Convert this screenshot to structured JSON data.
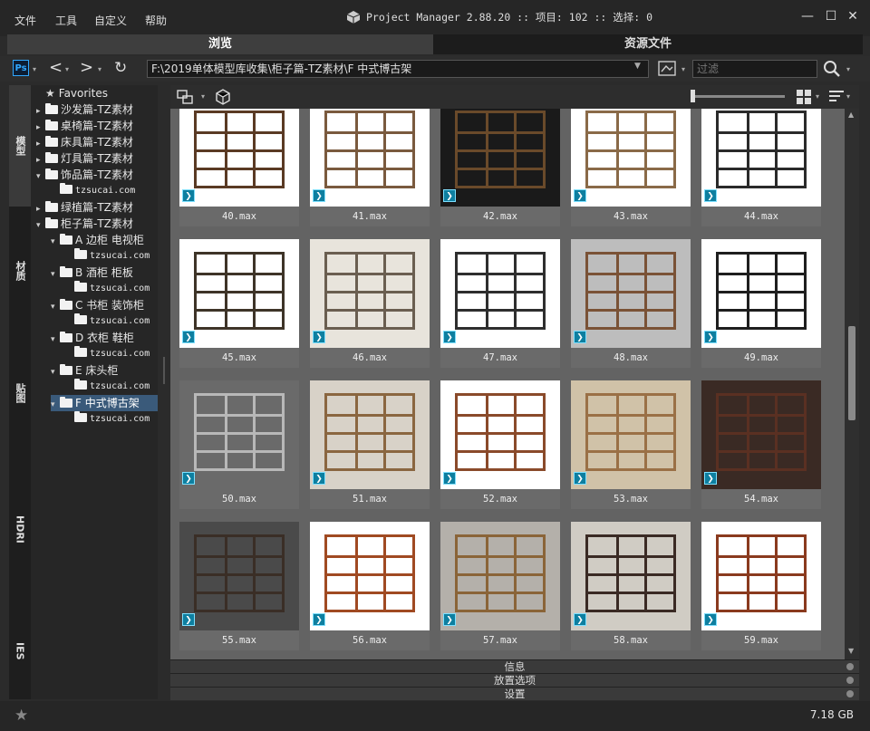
{
  "menu": [
    "文件",
    "工具",
    "自定义",
    "帮助"
  ],
  "title": "Project Manager 2.88.20 :: 项目: 102 :: 选择: 0",
  "tabs": {
    "browse": "浏览",
    "assets": "资源文件"
  },
  "toolbar": {
    "ps_label": "Ps",
    "path": "F:\\2019单体模型库收集\\柜子篇-TZ素材\\F 中式博古架",
    "filter_placeholder": "过滤"
  },
  "vtabs": [
    "模型",
    "材质",
    "贴图",
    "HDRI",
    "IES"
  ],
  "tree": [
    {
      "label": "Favorites",
      "level": 0,
      "arrow": "",
      "icon": "star"
    },
    {
      "label": "沙发篇-TZ素材",
      "level": 0,
      "arrow": "▸",
      "icon": "folder"
    },
    {
      "label": "桌椅篇-TZ素材",
      "level": 0,
      "arrow": "▸",
      "icon": "folder"
    },
    {
      "label": "床具篇-TZ素材",
      "level": 0,
      "arrow": "▸",
      "icon": "folder"
    },
    {
      "label": "灯具篇-TZ素材",
      "level": 0,
      "arrow": "▸",
      "icon": "folder"
    },
    {
      "label": "饰品篇-TZ素材",
      "level": 0,
      "arrow": "▾",
      "icon": "folder"
    },
    {
      "label": "tzsucai.com",
      "level": 1,
      "arrow": "",
      "icon": "folder",
      "mono": true
    },
    {
      "label": "绿植篇-TZ素材",
      "level": 0,
      "arrow": "▸",
      "icon": "folder"
    },
    {
      "label": "柜子篇-TZ素材",
      "level": 0,
      "arrow": "▾",
      "icon": "folder"
    },
    {
      "label": "A 边柜 电视柜",
      "level": 1,
      "arrow": "▾",
      "icon": "folder"
    },
    {
      "label": "tzsucai.com",
      "level": 2,
      "arrow": "",
      "icon": "folder",
      "mono": true
    },
    {
      "label": "B 酒柜 柜板",
      "level": 1,
      "arrow": "▾",
      "icon": "folder"
    },
    {
      "label": "tzsucai.com",
      "level": 2,
      "arrow": "",
      "icon": "folder",
      "mono": true
    },
    {
      "label": "C 书柜 装饰柜",
      "level": 1,
      "arrow": "▾",
      "icon": "folder"
    },
    {
      "label": "tzsucai.com",
      "level": 2,
      "arrow": "",
      "icon": "folder",
      "mono": true
    },
    {
      "label": "D 衣柜 鞋柜",
      "level": 1,
      "arrow": "▾",
      "icon": "folder"
    },
    {
      "label": "tzsucai.com",
      "level": 2,
      "arrow": "",
      "icon": "folder",
      "mono": true
    },
    {
      "label": "E 床头柜",
      "level": 1,
      "arrow": "▾",
      "icon": "folder"
    },
    {
      "label": "tzsucai.com",
      "level": 2,
      "arrow": "",
      "icon": "folder",
      "mono": true
    },
    {
      "label": "F 中式博古架",
      "level": 1,
      "arrow": "▾",
      "icon": "folder",
      "selected": true
    },
    {
      "label": "tzsucai.com",
      "level": 2,
      "arrow": "",
      "icon": "folder",
      "mono": true
    }
  ],
  "items": [
    {
      "label": "40.max",
      "bg": "#ffffff",
      "wood": "#5a3a24"
    },
    {
      "label": "41.max",
      "bg": "#ffffff",
      "wood": "#7a5a3e"
    },
    {
      "label": "42.max",
      "bg": "#1a1a1a",
      "wood": "#6a4a2a"
    },
    {
      "label": "43.max",
      "bg": "#ffffff",
      "wood": "#8a6a48"
    },
    {
      "label": "44.max",
      "bg": "#ffffff",
      "wood": "#2a2a2a"
    },
    {
      "label": "45.max",
      "bg": "#ffffff",
      "wood": "#3e3428"
    },
    {
      "label": "46.max",
      "bg": "#e8e4dc",
      "wood": "#6a5e50"
    },
    {
      "label": "47.max",
      "bg": "#ffffff",
      "wood": "#2e2e2e"
    },
    {
      "label": "48.max",
      "bg": "#bdbdbd",
      "wood": "#7a5236"
    },
    {
      "label": "49.max",
      "bg": "#ffffff",
      "wood": "#1e1e1e"
    },
    {
      "label": "50.max",
      "bg": "#6a6a6a",
      "wood": "#b8b8b8"
    },
    {
      "label": "51.max",
      "bg": "#d8d2c8",
      "wood": "#8a6640"
    },
    {
      "label": "52.max",
      "bg": "#ffffff",
      "wood": "#8a4a2a"
    },
    {
      "label": "53.max",
      "bg": "#d0c2a8",
      "wood": "#9a7046"
    },
    {
      "label": "54.max",
      "bg": "#3a2a24",
      "wood": "#5a3022"
    },
    {
      "label": "55.max",
      "bg": "#4a4a4a",
      "wood": "#3a2e26"
    },
    {
      "label": "56.max",
      "bg": "#ffffff",
      "wood": "#a04a22"
    },
    {
      "label": "57.max",
      "bg": "#b4b0aa",
      "wood": "#8a6438"
    },
    {
      "label": "58.max",
      "bg": "#d0ccc4",
      "wood": "#3a2a24"
    },
    {
      "label": "59.max",
      "bg": "#ffffff",
      "wood": "#8a3a1e"
    }
  ],
  "panels": [
    "信息",
    "放置选项",
    "设置"
  ],
  "status": {
    "size": "7.18 GB"
  }
}
